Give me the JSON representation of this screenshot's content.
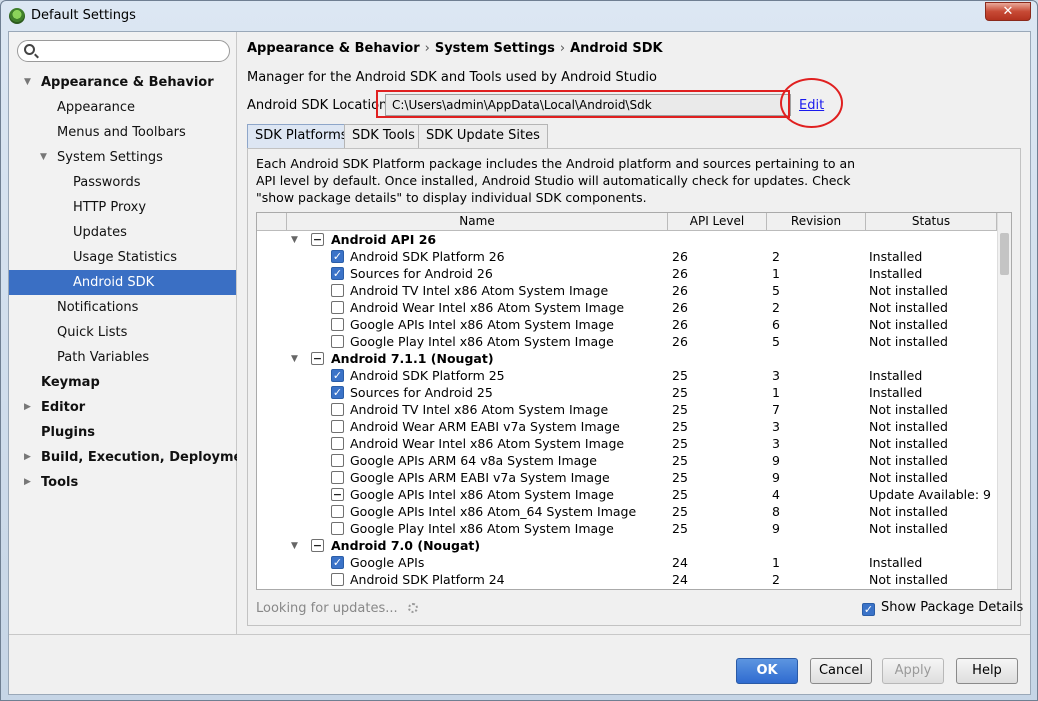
{
  "window": {
    "title": "Default Settings",
    "close_label": "✕"
  },
  "search": {
    "value": "",
    "placeholder": ""
  },
  "sidebar": {
    "items": [
      {
        "label": "Appearance & Behavior"
      },
      {
        "label": "Appearance"
      },
      {
        "label": "Menus and Toolbars"
      },
      {
        "label": "System Settings"
      },
      {
        "label": "Passwords"
      },
      {
        "label": "HTTP Proxy"
      },
      {
        "label": "Updates"
      },
      {
        "label": "Usage Statistics"
      },
      {
        "label": "Android SDK"
      },
      {
        "label": "Notifications"
      },
      {
        "label": "Quick Lists"
      },
      {
        "label": "Path Variables"
      },
      {
        "label": "Keymap"
      },
      {
        "label": "Editor"
      },
      {
        "label": "Plugins"
      },
      {
        "label": "Build, Execution, Deployment"
      },
      {
        "label": "Tools"
      }
    ]
  },
  "breadcrumb": [
    "Appearance & Behavior",
    "System Settings",
    "Android SDK"
  ],
  "breadcrumb_sep": "›",
  "description": "Manager for the Android SDK and Tools used by Android Studio",
  "sdk_location": {
    "label": "Android SDK Location",
    "value": "C:\\Users\\admin\\AppData\\Local\\Android\\Sdk",
    "edit_label": "Edit"
  },
  "tabs": [
    "SDK Platforms",
    "SDK Tools",
    "SDK Update Sites"
  ],
  "panel_description": "Each Android SDK Platform package includes the Android platform and sources pertaining to an API level by default. Once installed, Android Studio will automatically check for updates. Check \"show package details\" to display individual SDK components.",
  "table": {
    "columns": [
      "Name",
      "API Level",
      "Revision",
      "Status"
    ],
    "groups": [
      {
        "name": "Android API 26",
        "items": [
          {
            "name": "Android SDK Platform 26",
            "api": "26",
            "rev": "2",
            "status": "Installed",
            "checked": true
          },
          {
            "name": "Sources for Android 26",
            "api": "26",
            "rev": "1",
            "status": "Installed",
            "checked": true
          },
          {
            "name": "Android TV Intel x86 Atom System Image",
            "api": "26",
            "rev": "5",
            "status": "Not installed",
            "checked": false
          },
          {
            "name": "Android Wear Intel x86 Atom System Image",
            "api": "26",
            "rev": "2",
            "status": "Not installed",
            "checked": false
          },
          {
            "name": "Google APIs Intel x86 Atom System Image",
            "api": "26",
            "rev": "6",
            "status": "Not installed",
            "checked": false
          },
          {
            "name": "Google Play Intel x86 Atom System Image",
            "api": "26",
            "rev": "5",
            "status": "Not installed",
            "checked": false
          }
        ]
      },
      {
        "name": "Android 7.1.1 (Nougat)",
        "items": [
          {
            "name": "Android SDK Platform 25",
            "api": "25",
            "rev": "3",
            "status": "Installed",
            "checked": true
          },
          {
            "name": "Sources for Android 25",
            "api": "25",
            "rev": "1",
            "status": "Installed",
            "checked": true
          },
          {
            "name": "Android TV Intel x86 Atom System Image",
            "api": "25",
            "rev": "7",
            "status": "Not installed",
            "checked": false
          },
          {
            "name": "Android Wear ARM EABI v7a System Image",
            "api": "25",
            "rev": "3",
            "status": "Not installed",
            "checked": false
          },
          {
            "name": "Android Wear Intel x86 Atom System Image",
            "api": "25",
            "rev": "3",
            "status": "Not installed",
            "checked": false
          },
          {
            "name": "Google APIs ARM 64 v8a System Image",
            "api": "25",
            "rev": "9",
            "status": "Not installed",
            "checked": false
          },
          {
            "name": "Google APIs ARM EABI v7a System Image",
            "api": "25",
            "rev": "9",
            "status": "Not installed",
            "checked": false
          },
          {
            "name": "Google APIs Intel x86 Atom System Image",
            "api": "25",
            "rev": "4",
            "status": "Update Available: 9",
            "partial": true
          },
          {
            "name": "Google APIs Intel x86 Atom_64 System Image",
            "api": "25",
            "rev": "8",
            "status": "Not installed",
            "checked": false
          },
          {
            "name": "Google Play Intel x86 Atom System Image",
            "api": "25",
            "rev": "9",
            "status": "Not installed",
            "checked": false
          }
        ]
      },
      {
        "name": "Android 7.0 (Nougat)",
        "items": [
          {
            "name": "Google APIs",
            "api": "24",
            "rev": "1",
            "status": "Installed",
            "checked": true
          },
          {
            "name": "Android SDK Platform 24",
            "api": "24",
            "rev": "2",
            "status": "Not installed",
            "checked": false
          }
        ]
      }
    ]
  },
  "loading_text": "Looking for updates...",
  "show_details": {
    "label": "Show Package Details",
    "checked": true
  },
  "buttons": {
    "ok": "OK",
    "cancel": "Cancel",
    "apply": "Apply",
    "help": "Help"
  },
  "colors": {
    "selection": "#3a6fc4",
    "highlight_red": "#e02020",
    "link": "#1a1aee"
  }
}
